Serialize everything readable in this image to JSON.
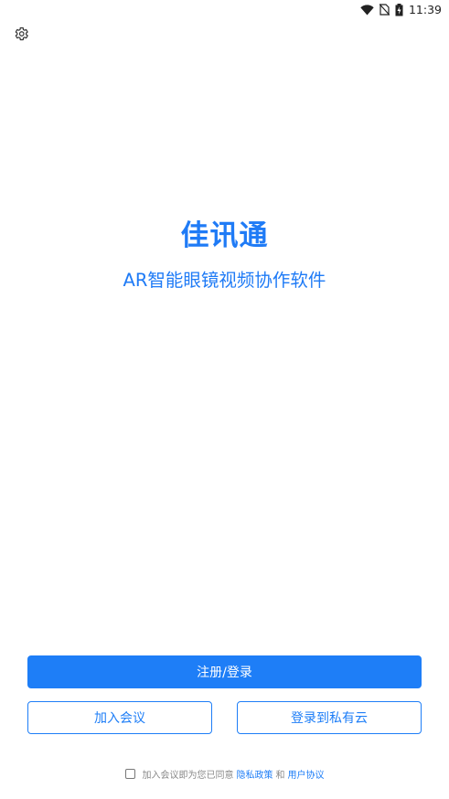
{
  "status_bar": {
    "time": "11:39",
    "icons": [
      "wifi-icon",
      "no-sim-icon",
      "battery-charging-icon"
    ]
  },
  "toolbar": {
    "settings_icon": "gear-icon"
  },
  "brand": {
    "title": "佳讯通",
    "subtitle": "AR智能眼镜视频协作软件"
  },
  "actions": {
    "register_login": "注册/登录",
    "join_meeting": "加入会议",
    "login_private_cloud": "登录到私有云"
  },
  "agreement": {
    "text": "加入会议即为您已同意",
    "privacy_policy": "隐私政策",
    "and": "和",
    "user_agreement": "用户协议",
    "checked": false
  },
  "colors": {
    "accent": "#1e7ef7",
    "muted_text": "#888888"
  }
}
